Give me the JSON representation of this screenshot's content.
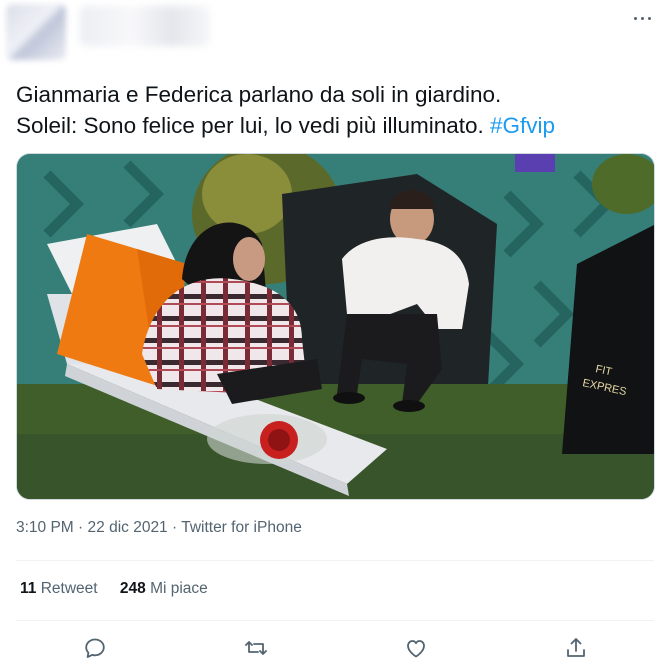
{
  "tweet": {
    "line1": "Gianmaria e Federica parlano da soli in giardino.",
    "line2": "Soleil: Sono felice per lui, lo vedi più illuminato.",
    "hashtag": "#Gfvip"
  },
  "media": {
    "sign_line1": "FIT",
    "sign_line2": "EXPRES"
  },
  "meta": {
    "time": "3:10 PM",
    "date": "22 dic 2021",
    "separator": "·",
    "source": "Twitter for iPhone"
  },
  "stats": {
    "retweet_count": "11",
    "retweet_label": "Retweet",
    "like_count": "248",
    "like_label": "Mi piace"
  },
  "icons": {
    "more": "more-icon",
    "reply": "reply-icon",
    "retweet": "retweet-icon",
    "like": "like-icon",
    "share": "share-icon"
  },
  "colors": {
    "link": "#1d9bf0",
    "secondary_text": "#536471",
    "primary_text": "#0f1419"
  }
}
